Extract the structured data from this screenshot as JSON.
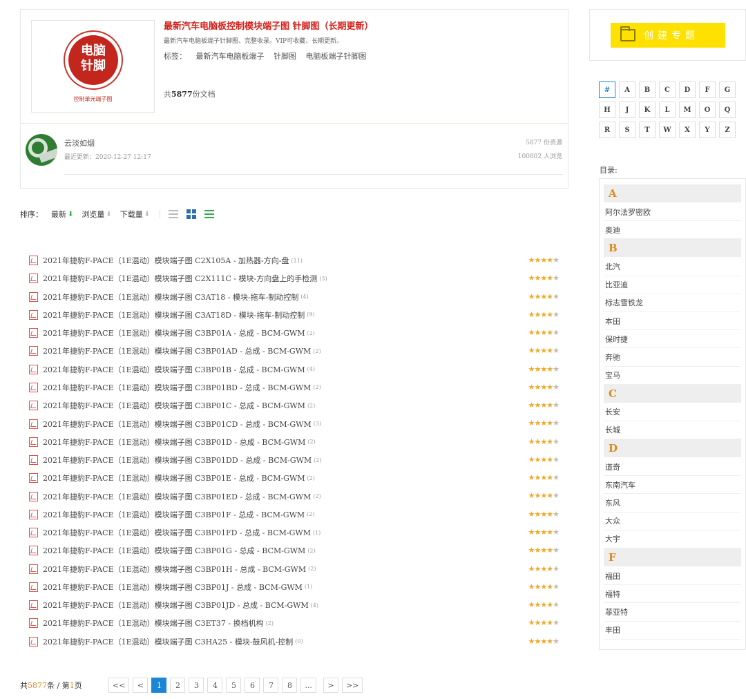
{
  "topic": {
    "title": "最新汽车电脑板控制模块端子图 针脚图（长期更新）",
    "description": "最新汽车电脑板端子针脚图、完整收录。VIP可收藏、长期更新。",
    "tags_label": "标签：",
    "tags": [
      "最新汽车电脑板端子",
      "针脚图",
      "电脑板端子针脚图"
    ],
    "count_prefix": "共",
    "count": "5877",
    "count_suffix": "份文档",
    "logo_line1": "电脑",
    "logo_line2": "针脚",
    "logo_sub": "控制单元端子图"
  },
  "author": {
    "name": "云淡如烟",
    "updated": "最近更新：2020-12-27 12:17",
    "resources": "5877 份资源",
    "views": "100802 人浏览"
  },
  "sort": {
    "label": "排序：",
    "options": [
      "最新",
      "浏览量",
      "下载量"
    ]
  },
  "documents": [
    {
      "title": "2021年捷豹F-PACE（1E混动）模块端子图 C2X105A - 加热器-方向-盘",
      "count": "(11)",
      "rating": 4
    },
    {
      "title": "2021年捷豹F-PACE（1E混动）模块端子图 C2X111C - 模块-方向盘上的手检测",
      "count": "(3)",
      "rating": 4
    },
    {
      "title": "2021年捷豹F-PACE（1E混动）模块端子图 C3AT18 - 模块-拖车-制动控制",
      "count": "(4)",
      "rating": 4
    },
    {
      "title": "2021年捷豹F-PACE（1E混动）模块端子图 C3AT18D - 模块-拖车-制动控制",
      "count": "(9)",
      "rating": 4
    },
    {
      "title": "2021年捷豹F-PACE（1E混动）模块端子图 C3BP01A - 总成 - BCM-GWM",
      "count": "(2)",
      "rating": 4
    },
    {
      "title": "2021年捷豹F-PACE（1E混动）模块端子图 C3BP01AD - 总成 - BCM-GWM",
      "count": "(2)",
      "rating": 4
    },
    {
      "title": "2021年捷豹F-PACE（1E混动）模块端子图 C3BP01B - 总成 - BCM-GWM",
      "count": "(4)",
      "rating": 4
    },
    {
      "title": "2021年捷豹F-PACE（1E混动）模块端子图 C3BP01BD - 总成 - BCM-GWM",
      "count": "(2)",
      "rating": 4
    },
    {
      "title": "2021年捷豹F-PACE（1E混动）模块端子图 C3BP01C - 总成 - BCM-GWM",
      "count": "(2)",
      "rating": 4
    },
    {
      "title": "2021年捷豹F-PACE（1E混动）模块端子图 C3BP01CD - 总成 - BCM-GWM",
      "count": "(3)",
      "rating": 4
    },
    {
      "title": "2021年捷豹F-PACE（1E混动）模块端子图 C3BP01D - 总成 - BCM-GWM",
      "count": "(2)",
      "rating": 4
    },
    {
      "title": "2021年捷豹F-PACE（1E混动）模块端子图 C3BP01DD - 总成 - BCM-GWM",
      "count": "(2)",
      "rating": 4
    },
    {
      "title": "2021年捷豹F-PACE（1E混动）模块端子图 C3BP01E - 总成 - BCM-GWM",
      "count": "(2)",
      "rating": 4
    },
    {
      "title": "2021年捷豹F-PACE（1E混动）模块端子图 C3BP01ED - 总成 - BCM-GWM",
      "count": "(2)",
      "rating": 4
    },
    {
      "title": "2021年捷豹F-PACE（1E混动）模块端子图 C3BP01F - 总成 - BCM-GWM",
      "count": "(2)",
      "rating": 4
    },
    {
      "title": "2021年捷豹F-PACE（1E混动）模块端子图 C3BP01FD - 总成 - BCM-GWM",
      "count": "(1)",
      "rating": 4
    },
    {
      "title": "2021年捷豹F-PACE（1E混动）模块端子图 C3BP01G - 总成 - BCM-GWM",
      "count": "(2)",
      "rating": 4
    },
    {
      "title": "2021年捷豹F-PACE（1E混动）模块端子图 C3BP01H - 总成 - BCM-GWM",
      "count": "(2)",
      "rating": 4
    },
    {
      "title": "2021年捷豹F-PACE（1E混动）模块端子图 C3BP01J - 总成 - BCM-GWM",
      "count": "(1)",
      "rating": 4
    },
    {
      "title": "2021年捷豹F-PACE（1E混动）模块端子图 C3BP01JD - 总成 - BCM-GWM",
      "count": "(4)",
      "rating": 4
    },
    {
      "title": "2021年捷豹F-PACE（1E混动）模块端子图 C3ET37 - 换档机构",
      "count": "(2)",
      "rating": 4
    },
    {
      "title": "2021年捷豹F-PACE（1E混动）模块端子图 C3HA25 - 模块-鼓风机-控制",
      "count": "(0)",
      "rating": 4
    }
  ],
  "pagination": {
    "total_prefix": "共",
    "total": "5877",
    "total_mid": "条 / 第",
    "page": "1",
    "total_suffix": "页",
    "first": "<<",
    "prev": "<",
    "pages": [
      "1",
      "2",
      "3",
      "4",
      "5",
      "6",
      "7",
      "8"
    ],
    "ellipsis": "...",
    "next": ">",
    "last": ">>"
  },
  "create_button": "创建专题",
  "letters": [
    "#",
    "A",
    "B",
    "C",
    "D",
    "F",
    "G",
    "H",
    "J",
    "K",
    "L",
    "M",
    "O",
    "Q",
    "R",
    "S",
    "T",
    "W",
    "X",
    "Y",
    "Z"
  ],
  "toc": {
    "label": "目录:",
    "groups": [
      {
        "letter": "A",
        "items": [
          "阿尔法罗密欧",
          "奥迪"
        ]
      },
      {
        "letter": "B",
        "items": [
          "北汽",
          "比亚迪",
          "标志雪铁龙",
          "本田",
          "保时捷",
          "奔驰",
          "宝马"
        ]
      },
      {
        "letter": "C",
        "items": [
          "长安",
          "长城"
        ]
      },
      {
        "letter": "D",
        "items": [
          "道奇",
          "东南汽车",
          "东风",
          "大众",
          "大宇"
        ]
      },
      {
        "letter": "F",
        "items": [
          "福田",
          "福特",
          "菲亚特",
          "丰田"
        ]
      }
    ]
  },
  "colors": {
    "title_red": "#d5211b",
    "accent_blue": "#1b86d6",
    "star_gold": "#f5a623",
    "toc_orange": "#e08a1a",
    "create_yellow": "#ffe100"
  }
}
